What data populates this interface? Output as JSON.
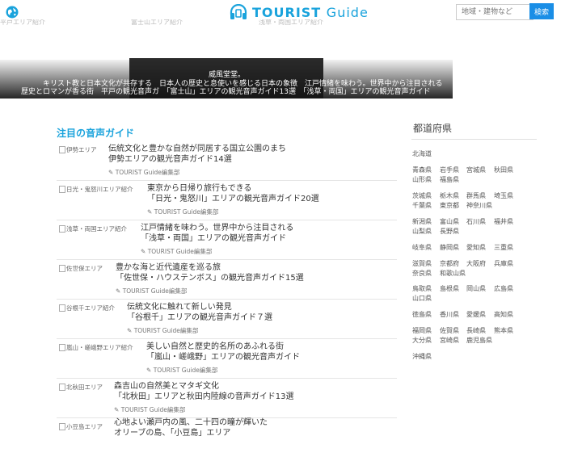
{
  "header": {
    "logo_text": "TOURIST",
    "logo_sub": "Guide",
    "search_placeholder": "地域・建物など",
    "search_button": "検索"
  },
  "slider": {
    "alt_texts": [
      "平戸エリア紹介",
      "富士山エリア紹介",
      "浅草・両国エリア紹介"
    ],
    "caption_top": "威風堂堂。",
    "line1": "キリスト教と日本文化が共存する　日本人の歴史と息使いを感じる日本の象徴　江戸情緒を味わう。世界中から注目される",
    "line2": "歴史とロマンが香る街　平戸の観光音声ガ　「富士山」エリアの観光音声ガイド13選　「浅草・両国」エリアの観光音声ガイド"
  },
  "section_title": "注目の音声ガイド",
  "articles": [
    {
      "thumb": "伊勢エリア",
      "title1": "伝統文化と豊かな自然が同居する国立公園のまち",
      "title2": "伊勢エリアの観光音声ガイド14選",
      "author": "TOURIST Guide編集部"
    },
    {
      "thumb": "日光・鬼怒川エリア紹介",
      "title1": "東京から日帰り旅行もできる",
      "title2": "「日光・鬼怒川」エリアの観光音声ガイド20選",
      "author": "TOURIST Guide編集部"
    },
    {
      "thumb": "浅草・両国エリア紹介",
      "title1": "江戸情緒を味わう。世界中から注目される",
      "title2": "「浅草・両国」エリアの観光音声ガイド",
      "author": "TOURIST Guide編集部"
    },
    {
      "thumb": "佐世保エリア",
      "title1": "豊かな海と近代遺産を巡る旅",
      "title2": "「佐世保・ハウステンボス」の観光音声ガイド15選",
      "author": "TOURIST Guide編集部"
    },
    {
      "thumb": "谷根千エリア紹介",
      "title1": "伝統文化に触れて新しい発見",
      "title2": "「谷根千」エリアの観光音声ガイド７選",
      "author": "TOURIST Guide編集部"
    },
    {
      "thumb": "嵐山・嵯峨野エリア紹介",
      "title1": "美しい自然と歴史的名所のあふれる街",
      "title2": "「嵐山・嵯峨野」エリアの観光音声ガイド",
      "author": "TOURIST Guide編集部"
    },
    {
      "thumb": "北秋田エリア",
      "title1": "森吉山の自然美とマタギ文化",
      "title2": "「北秋田」エリアと秋田内陸線の音声ガイド13選",
      "author": "TOURIST Guide編集部"
    },
    {
      "thumb": "小豆島エリア",
      "title1": "心地よい瀬戸内の風、二十四の瞳が輝いた",
      "title2": "オリーブの島、「小豆島」エリア",
      "author": ""
    }
  ],
  "sidebar": {
    "title": "都道府県",
    "rows": [
      [
        "北海道"
      ],
      [
        "青森県",
        "岩手県",
        "宮城県",
        "秋田県"
      ],
      [
        "山形県",
        "福島県"
      ],
      [
        "茨城県",
        "栃木県",
        "群馬県",
        "埼玉県"
      ],
      [
        "千葉県",
        "東京都",
        "神奈川県"
      ],
      [
        "新潟県",
        "富山県",
        "石川県",
        "福井県"
      ],
      [
        "山梨県",
        "長野県"
      ],
      [
        "岐阜県",
        "静岡県",
        "愛知県",
        "三重県"
      ],
      [
        "滋賀県",
        "京都府",
        "大阪府",
        "兵庫県"
      ],
      [
        "奈良県",
        "和歌山県"
      ],
      [
        "鳥取県",
        "島根県",
        "岡山県",
        "広島県"
      ],
      [
        "山口県"
      ],
      [
        "徳島県",
        "香川県",
        "愛媛県",
        "高知県"
      ],
      [
        "福岡県",
        "佐賀県",
        "長崎県",
        "熊本県"
      ],
      [
        "大分県",
        "宮崎県",
        "鹿児島県"
      ],
      [
        "沖縄県"
      ]
    ]
  },
  "colors": {
    "accent": "#1aa3dc",
    "button": "#1a8ee6"
  }
}
